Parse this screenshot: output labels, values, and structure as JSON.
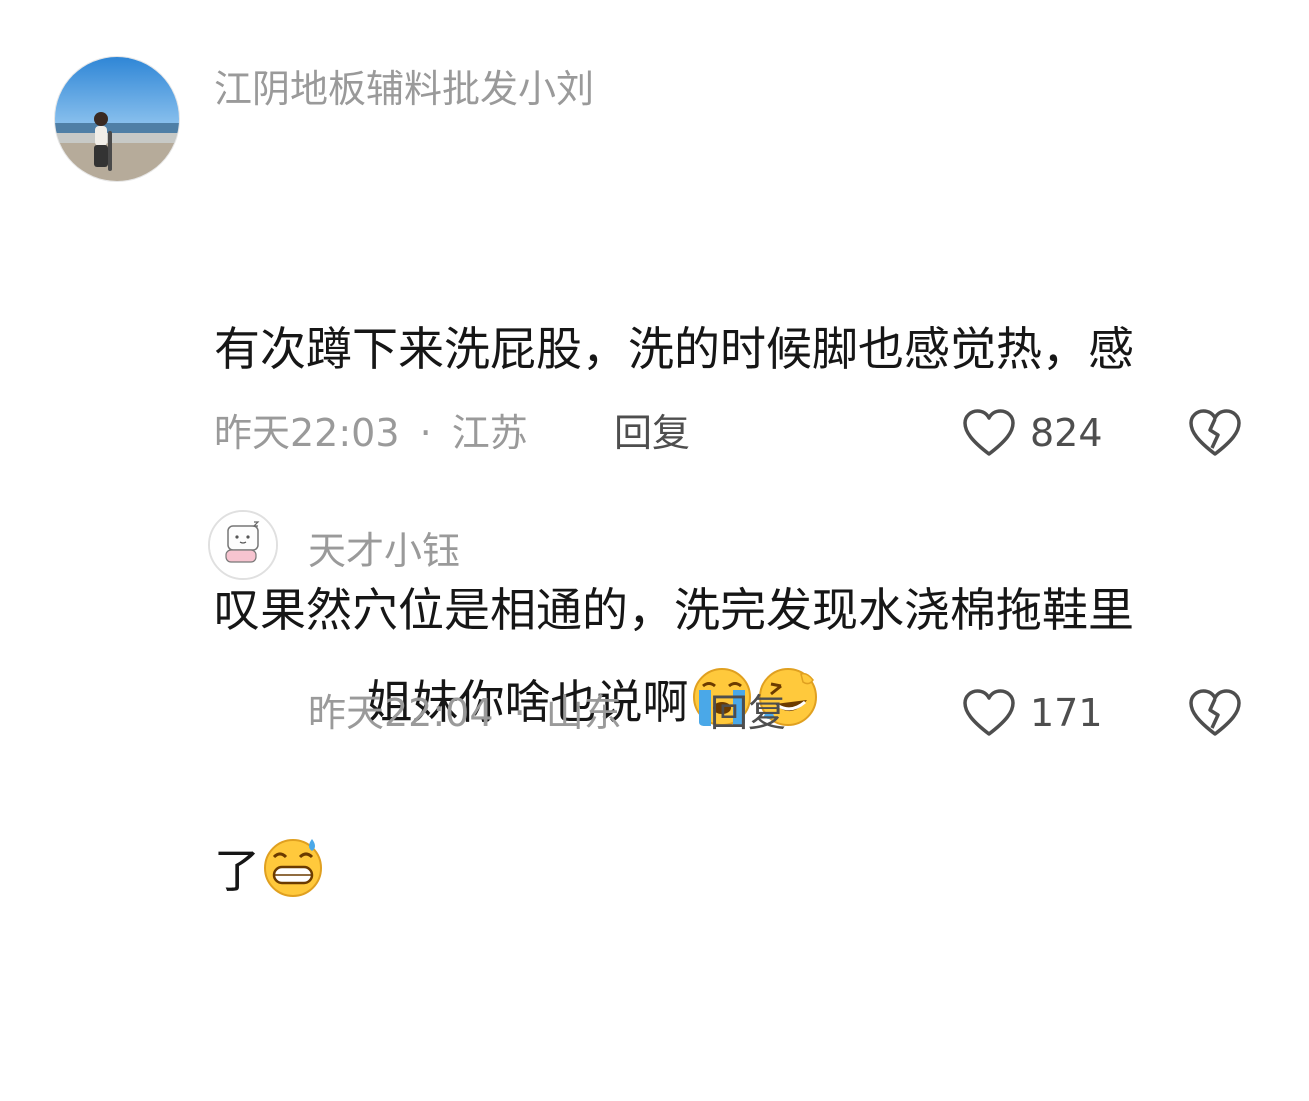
{
  "comments": [
    {
      "username": "江阴地板辅料批发小刘",
      "text_lines": [
        "有次蹲下来洗屁股，洗的时候脚也感觉热，感",
        "叹果然穴位是相通的，洗完发现水浇棉拖鞋里",
        "了"
      ],
      "emoji": "grinning-sweat-emoji",
      "timestamp": "昨天22:03",
      "separator": "·",
      "location": "江苏",
      "reply_label": "回复",
      "like_count": "824",
      "like_icon": "heart-outline-icon",
      "dislike_icon": "broken-heart-icon"
    },
    {
      "username": "天才小钰",
      "text": "姐妹你啥也说啊",
      "emojis": [
        "loudly-crying-emoji",
        "rolling-laughing-emoji"
      ],
      "timestamp": "昨天22:04",
      "separator": "·",
      "location": "山东",
      "reply_label": "回复",
      "like_count": "171",
      "like_icon": "heart-outline-icon",
      "dislike_icon": "broken-heart-icon"
    }
  ],
  "colors": {
    "username": "#9a9a9a",
    "text": "#161616",
    "meta": "#9a9a9a",
    "action": "#4e4e4e",
    "emoji_yellow": "#ffc93c",
    "emoji_tear": "#4aa8e8"
  }
}
